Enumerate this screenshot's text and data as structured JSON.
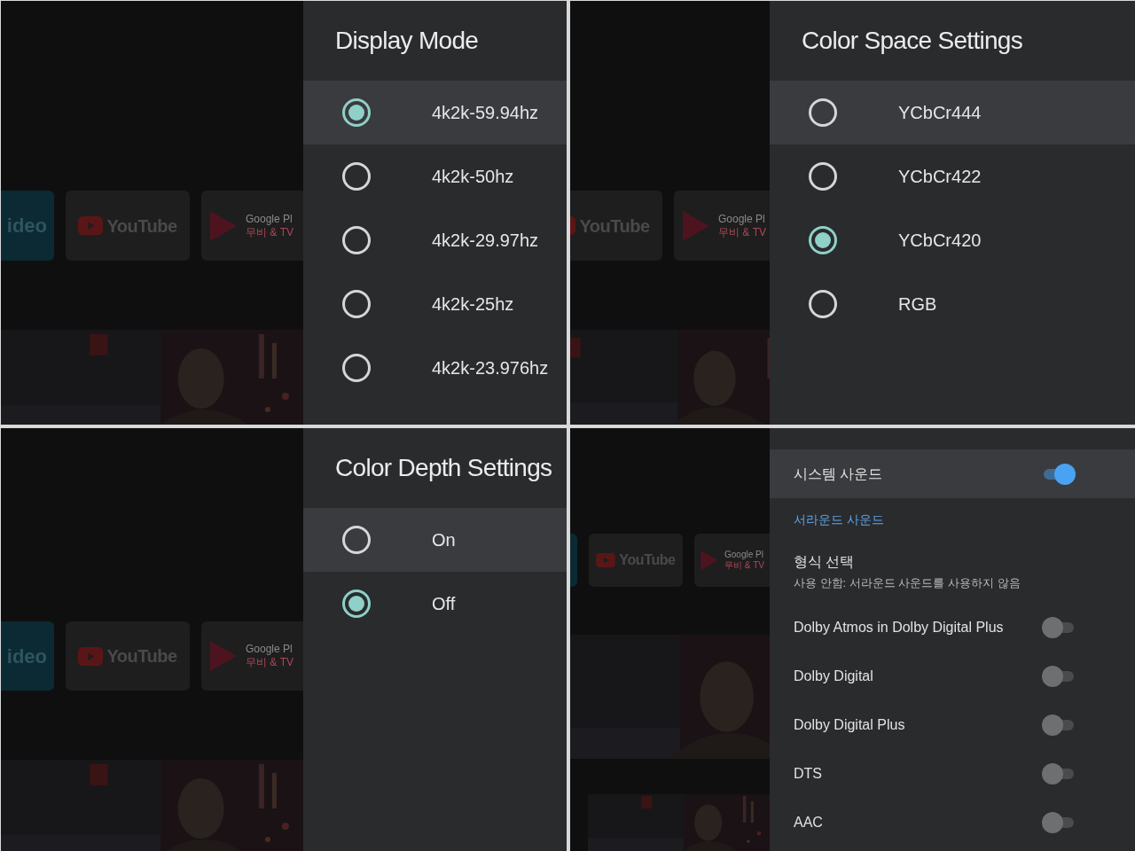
{
  "screens": [
    {
      "background": {
        "tiles": [
          {
            "kind": "video",
            "label": "ideo"
          },
          {
            "kind": "youtube",
            "label": "YouTube"
          },
          {
            "kind": "play",
            "label": "Google Pl",
            "sublabel": "무비 & TV"
          }
        ]
      },
      "panel": {
        "kind": "radio-list",
        "title": "Display Mode",
        "options": [
          {
            "label": "4k2k-59.94hz",
            "focused": true,
            "selected": true
          },
          {
            "label": "4k2k-50hz",
            "focused": false,
            "selected": false
          },
          {
            "label": "4k2k-29.97hz",
            "focused": false,
            "selected": false
          },
          {
            "label": "4k2k-25hz",
            "focused": false,
            "selected": false
          },
          {
            "label": "4k2k-23.976hz",
            "focused": false,
            "selected": false
          }
        ]
      }
    },
    {
      "background": {
        "tiles": [
          {
            "kind": "youtube",
            "label": "YouTube"
          },
          {
            "kind": "play",
            "label": "Google Pl",
            "sublabel": "무비 & TV"
          }
        ]
      },
      "panel": {
        "kind": "radio-list",
        "title": "Color Space Settings",
        "options": [
          {
            "label": "YCbCr444",
            "focused": true,
            "selected": false
          },
          {
            "label": "YCbCr422",
            "focused": false,
            "selected": false
          },
          {
            "label": "YCbCr420",
            "focused": false,
            "selected": true
          },
          {
            "label": "RGB",
            "focused": false,
            "selected": false
          }
        ]
      }
    },
    {
      "background": {
        "tiles": [
          {
            "kind": "video",
            "label": "ideo"
          },
          {
            "kind": "youtube",
            "label": "YouTube"
          },
          {
            "kind": "play",
            "label": "Google Pl",
            "sublabel": "무비 & TV"
          }
        ]
      },
      "panel": {
        "kind": "radio-list",
        "title": "Color Depth Settings",
        "options": [
          {
            "label": "On",
            "focused": true,
            "selected": false
          },
          {
            "label": "Off",
            "focused": false,
            "selected": true
          }
        ]
      }
    },
    {
      "background": {
        "tiles": [
          {
            "kind": "video"
          },
          {
            "kind": "youtube",
            "label": "YouTube"
          },
          {
            "kind": "play",
            "label": "Google Pl",
            "sublabel": "무비 & TV"
          }
        ]
      },
      "panel": {
        "kind": "settings-list",
        "items": [
          {
            "kind": "switch",
            "label": "시스템 사운드",
            "focused": true,
            "on": true
          },
          {
            "kind": "section",
            "label": "서라운드 사운드"
          },
          {
            "kind": "choice",
            "label": "형식 선택",
            "summary": "사용 안함: 서라운드 사운드를 사용하지 않음"
          },
          {
            "kind": "switch",
            "label": "Dolby Atmos in Dolby Digital Plus",
            "focused": false,
            "on": false
          },
          {
            "kind": "switch",
            "label": "Dolby Digital",
            "focused": false,
            "on": false
          },
          {
            "kind": "switch",
            "label": "Dolby Digital Plus",
            "focused": false,
            "on": false
          },
          {
            "kind": "switch",
            "label": "DTS",
            "focused": false,
            "on": false
          },
          {
            "kind": "switch",
            "label": "AAC",
            "focused": false,
            "on": false
          }
        ]
      }
    }
  ]
}
